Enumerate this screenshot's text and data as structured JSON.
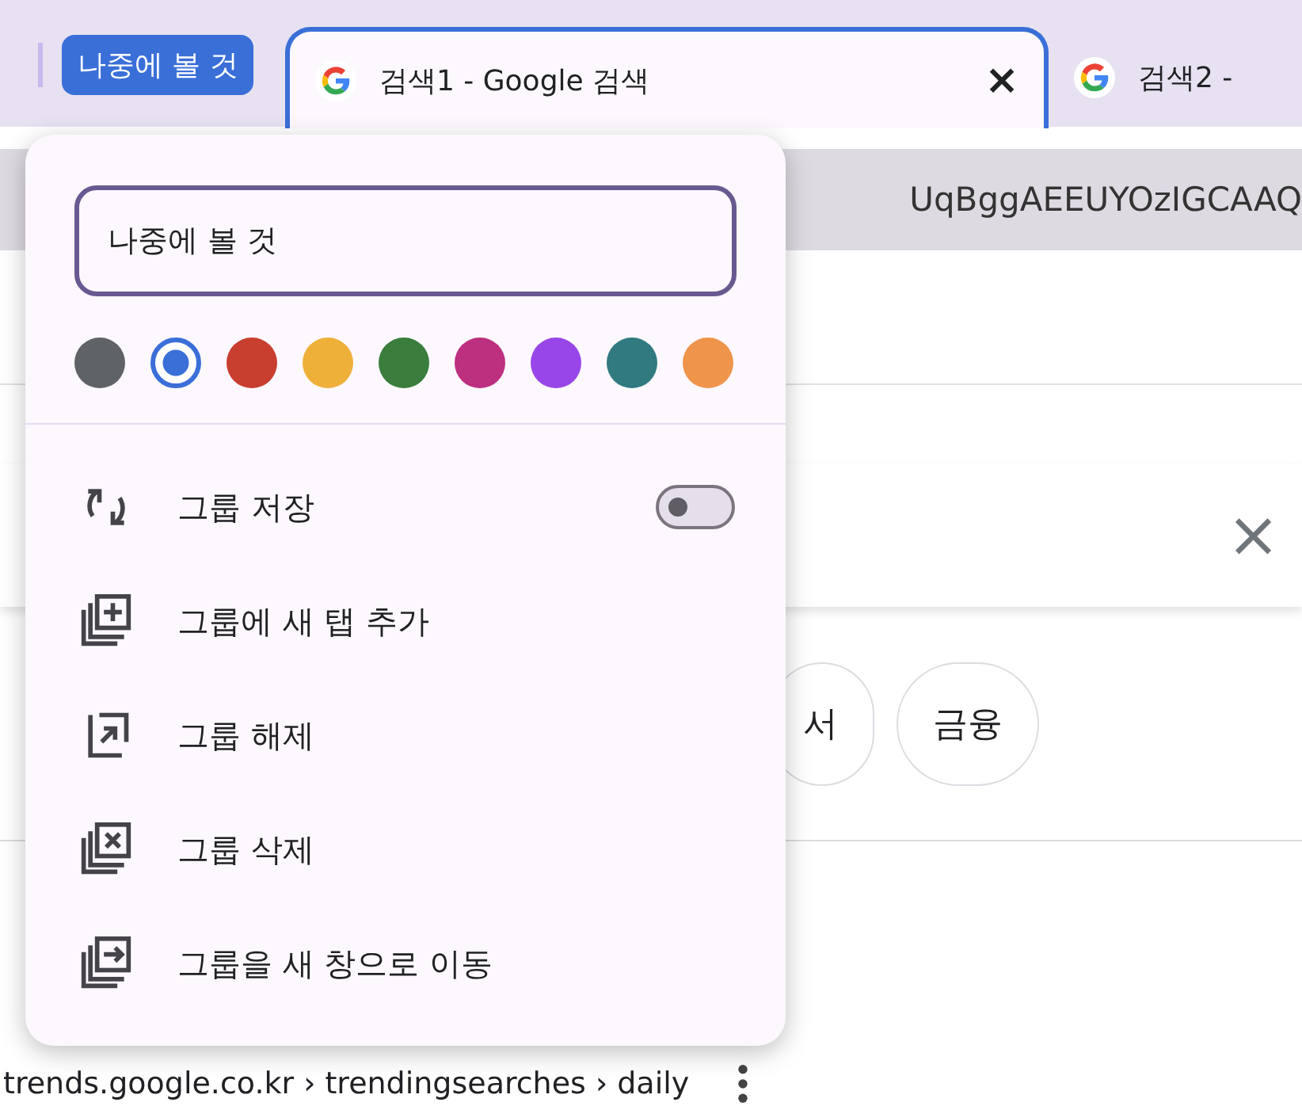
{
  "tab_strip": {
    "group": {
      "label": "나중에 볼 것",
      "color": "#3a6fd8"
    },
    "tabs": [
      {
        "title": "검색1 - Google 검색",
        "selected": true,
        "close": "×"
      },
      {
        "title": "검색2 -",
        "selected": false
      }
    ]
  },
  "address_bar": {
    "url_fragment": "UqBggAEEUYOzIGCAAQ"
  },
  "page": {
    "search_clear": "×",
    "chips": [
      {
        "label": "서"
      },
      {
        "label": "금융"
      }
    ],
    "result_url": "trends.google.co.kr › trendingsearches › daily"
  },
  "group_menu": {
    "name": {
      "value": "나중에 볼 것"
    },
    "colors": [
      {
        "color": "#5f6368",
        "selected": false
      },
      {
        "color": "#3a6fd8",
        "selected": true
      },
      {
        "color": "#c83e2f",
        "selected": false
      },
      {
        "color": "#efb03a",
        "selected": false
      },
      {
        "color": "#3a7d3d",
        "selected": false
      },
      {
        "color": "#bd2f7f",
        "selected": false
      },
      {
        "color": "#9846e8",
        "selected": false
      },
      {
        "color": "#307a80",
        "selected": false
      },
      {
        "color": "#ee944b",
        "selected": false
      }
    ],
    "items": [
      {
        "kind": "toggle",
        "label": "그룹 저장",
        "on": false
      },
      {
        "kind": "action",
        "label": "그룹에 새 탭 추가"
      },
      {
        "kind": "action",
        "label": "그룹 해제"
      },
      {
        "kind": "action",
        "label": "그룹 삭제"
      },
      {
        "kind": "action",
        "label": "그룹을 새 창으로 이동"
      }
    ]
  }
}
